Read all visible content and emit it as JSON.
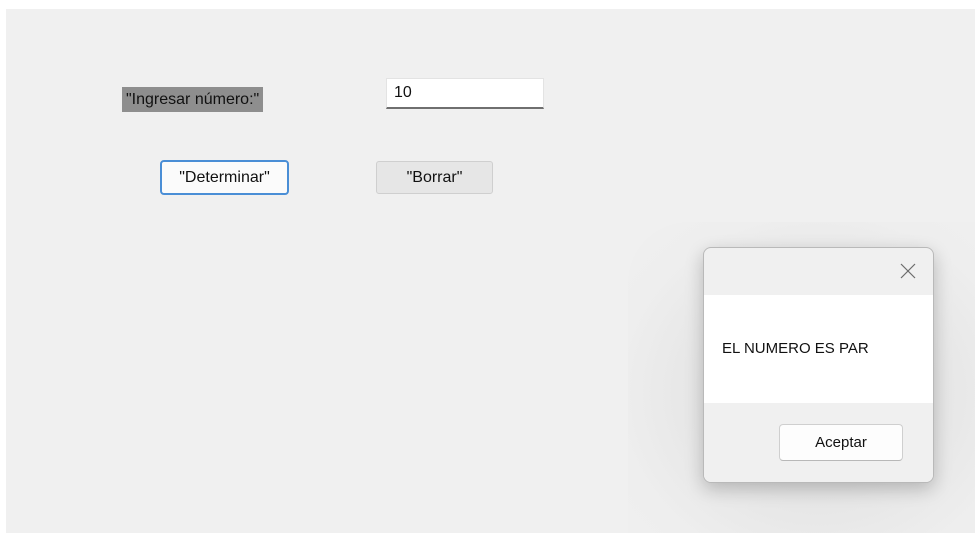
{
  "form": {
    "number_label": "\"Ingresar número:\"",
    "number_value": "10",
    "determine_button": "\"Determinar\"",
    "clear_button": "\"Borrar\""
  },
  "dialog": {
    "message": "EL NUMERO ES PAR",
    "ok_button": "Aceptar",
    "close_icon": "close-icon"
  },
  "colors": {
    "window_background": "#f0f0f0",
    "label_background": "#8e8e8e",
    "focus_border": "#4a8ed6",
    "dialog_body": "#ffffff"
  }
}
